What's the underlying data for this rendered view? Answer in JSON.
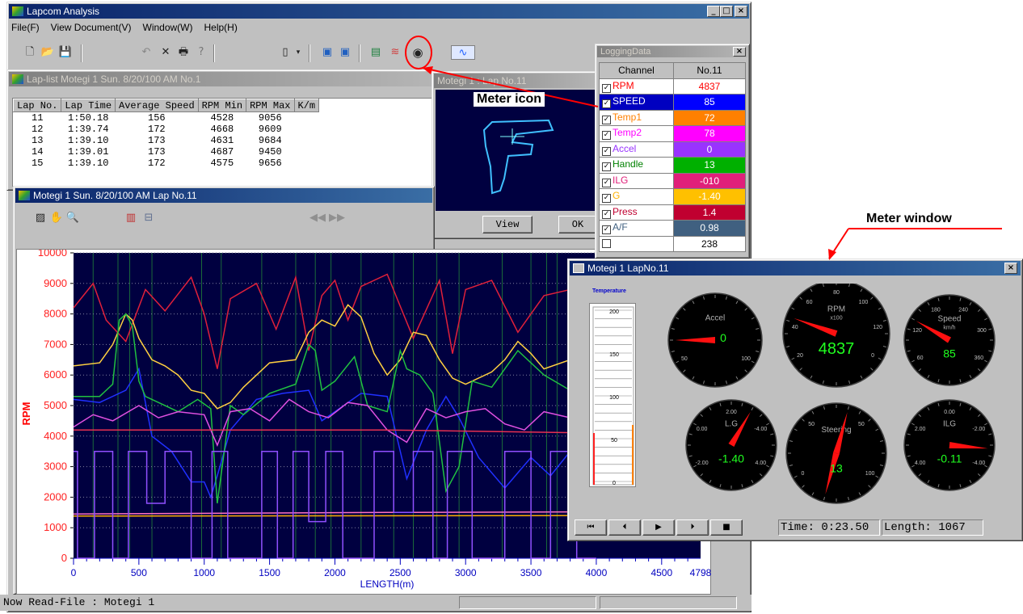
{
  "main_window": {
    "title": "Lapcom Analysis",
    "menu": [
      "File(F)",
      "View Document(V)",
      "Window(W)",
      "Help(H)"
    ],
    "status_text": "Now Read-File : Motegi 1"
  },
  "lap_list": {
    "title": "Lap-list  Motegi 1  Sun. 8/20/100 AM  No.1",
    "columns": [
      "Lap No.",
      "Lap Time",
      "Average Speed",
      "RPM Min",
      "RPM Max",
      "K/m"
    ],
    "rows": [
      [
        "11",
        "1:50.18",
        "156",
        "4528",
        "9056"
      ],
      [
        "12",
        "1:39.74",
        "172",
        "4668",
        "9609"
      ],
      [
        "13",
        "1:39.10",
        "173",
        "4631",
        "9684"
      ],
      [
        "14",
        "1:39.01",
        "173",
        "4687",
        "9450"
      ],
      [
        "15",
        "1:39.10",
        "172",
        "4575",
        "9656"
      ]
    ]
  },
  "course_window": {
    "title": "Motegi 1 : Lap No.11",
    "view_label": "View",
    "ok_label": "OK"
  },
  "graph_window": {
    "title": "Motegi 1  Sun. 8/20/100 AM  Lap No.11"
  },
  "logging_data": {
    "title": "LoggingData",
    "header_channel": "Channel",
    "header_no": "No.11",
    "channels": [
      {
        "name": "RPM",
        "value": "4837",
        "color": "#ff0000",
        "bg": "#ffffff",
        "vcolor": "#ff0000",
        "checked": true
      },
      {
        "name": "SPEED",
        "value": "85",
        "color": "#0000ff",
        "bg": "#0000ff",
        "vcolor": "#ffffff",
        "checked": true
      },
      {
        "name": "Temp1",
        "value": "72",
        "color": "#ff8000",
        "bg": "#ff8000",
        "vcolor": "#ffffff",
        "checked": true
      },
      {
        "name": "Temp2",
        "value": "78",
        "color": "#ff00ff",
        "bg": "#ff00ff",
        "vcolor": "#ffffff",
        "checked": true
      },
      {
        "name": "Accel",
        "value": "0",
        "color": "#9933ff",
        "bg": "#9933ff",
        "vcolor": "#ffffff",
        "checked": true
      },
      {
        "name": "Handle",
        "value": "13",
        "color": "#008000",
        "bg": "#00b000",
        "vcolor": "#ffffff",
        "checked": true
      },
      {
        "name": "ILG",
        "value": "-010",
        "color": "#e0207a",
        "bg": "#e0207a",
        "vcolor": "#ffffff",
        "checked": true
      },
      {
        "name": "G",
        "value": "-1.40",
        "color": "#ffb000",
        "bg": "#ffc000",
        "vcolor": "#ffffff",
        "checked": true
      },
      {
        "name": "Press",
        "value": "1.4",
        "color": "#c00030",
        "bg": "#c00030",
        "vcolor": "#ffffff",
        "checked": true
      },
      {
        "name": "A/F",
        "value": "0.98",
        "color": "#406080",
        "bg": "#406080",
        "vcolor": "#ffffff",
        "checked": true
      },
      {
        "name": "",
        "value": "238",
        "color": "#000000",
        "bg": "#ffffff",
        "vcolor": "#000000",
        "checked": false
      }
    ]
  },
  "chart_data": {
    "type": "line",
    "ylabel": "RPM",
    "xlabel": "LENGTH(m)",
    "ylim": [
      0,
      10000
    ],
    "yticks": [
      0,
      1000,
      2000,
      3000,
      4000,
      5000,
      6000,
      7000,
      8000,
      9000,
      10000
    ],
    "xlim": [
      0,
      4798
    ],
    "xticks": [
      0,
      500,
      1000,
      1500,
      2000,
      2500,
      3000,
      3500,
      4000,
      4500,
      4798
    ],
    "grid": true,
    "series": [
      {
        "name": "RPM",
        "color": "#e0203a",
        "x": [
          0,
          150,
          250,
          400,
          550,
          700,
          900,
          1000,
          1100,
          1200,
          1400,
          1550,
          1700,
          1800,
          1900,
          2000,
          2100,
          2200,
          2400,
          2600,
          2800,
          2900,
          3000,
          3200,
          3400,
          3600,
          3800,
          4000
        ],
        "values": [
          8200,
          9000,
          7800,
          7100,
          8800,
          8100,
          9200,
          8000,
          6200,
          8500,
          9000,
          7500,
          9200,
          6800,
          8600,
          9100,
          7800,
          8900,
          9300,
          7200,
          9100,
          6700,
          8800,
          9100,
          7400,
          8600,
          8800,
          8200
        ]
      },
      {
        "name": "SPEED",
        "color": "#2030ff",
        "x": [
          0,
          200,
          400,
          500,
          600,
          750,
          900,
          1000,
          1050,
          1100,
          1200,
          1400,
          1600,
          1800,
          1900,
          2000,
          2200,
          2400,
          2550,
          2700,
          2850,
          2950,
          3100,
          3300,
          3500,
          3650,
          3800,
          4000
        ],
        "values": [
          5200,
          5100,
          5500,
          6200,
          4000,
          3500,
          2500,
          2500,
          2000,
          2700,
          4200,
          5200,
          5400,
          5500,
          4500,
          4800,
          5400,
          5300,
          2600,
          4200,
          5300,
          4600,
          3300,
          2300,
          3300,
          2700,
          3500,
          5000
        ]
      },
      {
        "name": "Temp1",
        "color": "#ffd040",
        "x": [
          0,
          200,
          300,
          350,
          400,
          450,
          500,
          600,
          700,
          800,
          900,
          1000,
          1100,
          1200,
          1300,
          1500,
          1700,
          1800,
          1900,
          2000,
          2100,
          2200,
          2300,
          2400,
          2500,
          2600,
          2700,
          2800,
          2900,
          3000,
          3200,
          3300,
          3400,
          3500,
          3600,
          3800,
          4000
        ],
        "values": [
          6300,
          6400,
          7000,
          7500,
          8000,
          7800,
          7200,
          6500,
          6300,
          6000,
          5500,
          5400,
          4900,
          5100,
          5600,
          6400,
          6500,
          7400,
          7800,
          7600,
          8300,
          7900,
          6700,
          6000,
          6500,
          7400,
          7300,
          6500,
          5900,
          5700,
          6100,
          6500,
          7100,
          6700,
          6200,
          6500,
          6400
        ]
      },
      {
        "name": "Handle",
        "color": "#20c040",
        "x": [
          0,
          200,
          300,
          350,
          400,
          450,
          500,
          550,
          650,
          800,
          950,
          1050,
          1100,
          1200,
          1300,
          1500,
          1700,
          1800,
          1850,
          1900,
          2000,
          2150,
          2250,
          2400,
          2500,
          2550,
          2650,
          2750,
          2850,
          2950,
          3050,
          3200,
          3400,
          3600,
          3800,
          4000
        ],
        "values": [
          5300,
          5300,
          5700,
          7800,
          8000,
          7600,
          5800,
          5300,
          5100,
          4800,
          5200,
          4900,
          1800,
          5000,
          4700,
          5400,
          5700,
          7000,
          6800,
          5500,
          5800,
          6600,
          5000,
          4800,
          6800,
          6200,
          6000,
          5400,
          2200,
          3000,
          5800,
          5600,
          6800,
          6000,
          5500,
          5300
        ]
      },
      {
        "name": "Temp2",
        "color": "#e050e0",
        "x": [
          0,
          150,
          300,
          500,
          650,
          800,
          1000,
          1100,
          1200,
          1350,
          1500,
          1650,
          1800,
          1950,
          2100,
          2250,
          2400,
          2550,
          2700,
          2850,
          3000,
          3150,
          3300,
          3450,
          3600,
          3800,
          4000
        ],
        "values": [
          4300,
          4700,
          4500,
          5000,
          4600,
          4800,
          4700,
          3700,
          4800,
          4900,
          4500,
          5200,
          4800,
          4600,
          5100,
          5000,
          4200,
          3800,
          4900,
          4600,
          4800,
          4900,
          4400,
          4200,
          4800,
          4600,
          4700
        ]
      },
      {
        "name": "ILG",
        "color": "#e83050",
        "x": [
          0,
          2400,
          4000
        ],
        "values": [
          4200,
          4200,
          4100
        ]
      },
      {
        "name": "Press",
        "color": "#ff70c0",
        "x": [
          0,
          2400,
          4000
        ],
        "values": [
          1450,
          1500,
          1520
        ]
      },
      {
        "name": "G",
        "color": "#ffb000",
        "x": [
          0,
          4000
        ],
        "values": [
          1380,
          1400
        ]
      },
      {
        "name": "Accel",
        "color": "#9050ff",
        "x": [
          0,
          30,
          30,
          160,
          160,
          300,
          300,
          420,
          420,
          560,
          560,
          700,
          700,
          900,
          900,
          1060,
          1060,
          1180,
          1180,
          1440,
          1440,
          1560,
          1560,
          1680,
          1680,
          1800,
          1800,
          1930,
          1930,
          2060,
          2060,
          2300,
          2300,
          2450,
          2450,
          2600,
          2600,
          2750,
          2750,
          2860,
          2860,
          3050,
          3050,
          3300,
          3300,
          3500,
          3500,
          3650,
          3650,
          3850,
          3850,
          4000
        ],
        "values": [
          3500,
          3500,
          0,
          0,
          3500,
          3500,
          0,
          0,
          3500,
          3500,
          1800,
          1800,
          3500,
          3500,
          0,
          0,
          3500,
          3500,
          0,
          0,
          3500,
          3500,
          0,
          0,
          3500,
          3500,
          1200,
          1200,
          3500,
          3500,
          0,
          0,
          3500,
          3500,
          1500,
          1500,
          3500,
          3500,
          0,
          0,
          3500,
          3500,
          0,
          0,
          3500,
          3500,
          0,
          0,
          3500,
          3500,
          0,
          0
        ]
      }
    ]
  },
  "meter_window": {
    "title": "Motegi 1  LapNo.11",
    "temperature_label": "Temperature",
    "temp_ticks": [
      "200",
      "150",
      "100",
      "50",
      "0"
    ],
    "time_text": "Time: 0:23.50",
    "length_text": "Length: 1067",
    "gauges": [
      {
        "label": "Accel",
        "value": "0",
        "value_color": "#20ff20",
        "needle_deg": 270,
        "ticks": [
          "50",
          "100"
        ]
      },
      {
        "label": "RPM",
        "sub": "x100",
        "value": "4837",
        "value_color": "#20ff20",
        "needle_deg": 290,
        "ticks": [
          "20",
          "40",
          "60",
          "80",
          "100",
          "120",
          "0"
        ]
      },
      {
        "label": "Speed",
        "sub": "km/h",
        "value": "85",
        "value_color": "#20ff20",
        "needle_deg": 300,
        "ticks": [
          "60",
          "120",
          "180",
          "240",
          "300",
          "360"
        ]
      },
      {
        "label": "L.G",
        "value": "-1.40",
        "value_color": "#20ff20",
        "needle_deg": 30,
        "ticks": [
          "-2.00",
          "0.00",
          "2.00",
          "-4.00",
          "4.00"
        ]
      },
      {
        "label": "Steering",
        "value": "13",
        "value_color": "#20ff20",
        "needle_deg": 15,
        "ticks": [
          "0",
          "50",
          "50",
          "100"
        ]
      },
      {
        "label": "ILG",
        "value": "-0.11",
        "value_color": "#20ff20",
        "needle_deg": 95,
        "ticks": [
          "4.00",
          "2.00",
          "0.00",
          "-2.00",
          "-4.00"
        ]
      }
    ]
  },
  "annotations": {
    "meter_icon": "Meter icon",
    "meter_window": "Meter window"
  }
}
